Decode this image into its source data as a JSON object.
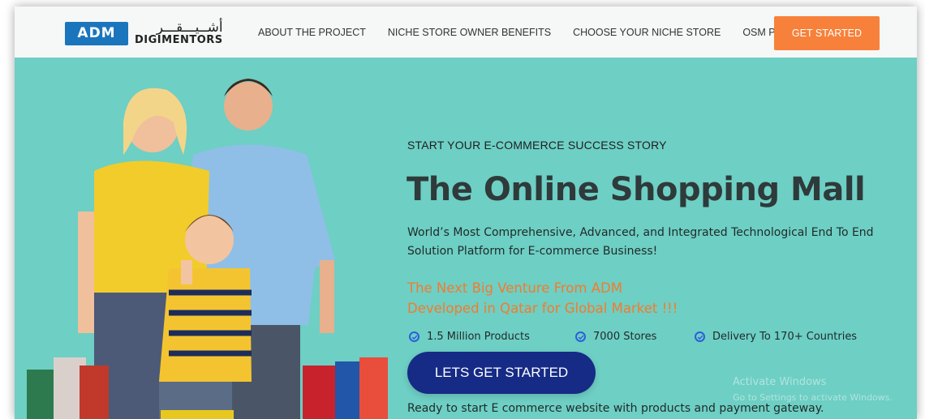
{
  "logo": {
    "badge": "ADM",
    "arabic": "أشــيـــقـــر",
    "wordmark": "DIGIMENTORS"
  },
  "nav": {
    "links": [
      {
        "label": "ABOUT THE PROJECT"
      },
      {
        "label": "NICHE STORE OWNER BENEFITS"
      },
      {
        "label": "CHOOSE YOUR NICHE STORE"
      },
      {
        "label": "OSM PRICING"
      }
    ],
    "cta": "GET STARTED"
  },
  "hero": {
    "eyebrow": "START YOUR E-COMMERCE SUCCESS STORY",
    "headline": "The Online Shopping Mall",
    "subcopy": "World’s Most Comprehensive, Advanced, and Integrated Technological End To End Solution Platform for E-commerce Business!",
    "orange_line1": "The Next Big Venture From ADM",
    "orange_line2": "Developed in Qatar for Global Market !!!",
    "features": [
      {
        "label": "1.5 Million Products"
      },
      {
        "label": "7000  Stores"
      },
      {
        "label": "Delivery To 170+ Countries"
      }
    ],
    "cta": "LETS GET STARTED",
    "ready_text": "Ready to start E commerce website with products and  payment gateway."
  },
  "overlay": {
    "activate_title": "Activate Windows",
    "activate_sub": "Go to Settings to activate Windows."
  },
  "colors": {
    "hero_bg": "#6ecfc4",
    "nav_bg": "#f6f7f7",
    "accent_orange": "#f7813a",
    "cta_blue": "#152b86",
    "logo_blue": "#1b75bc"
  }
}
